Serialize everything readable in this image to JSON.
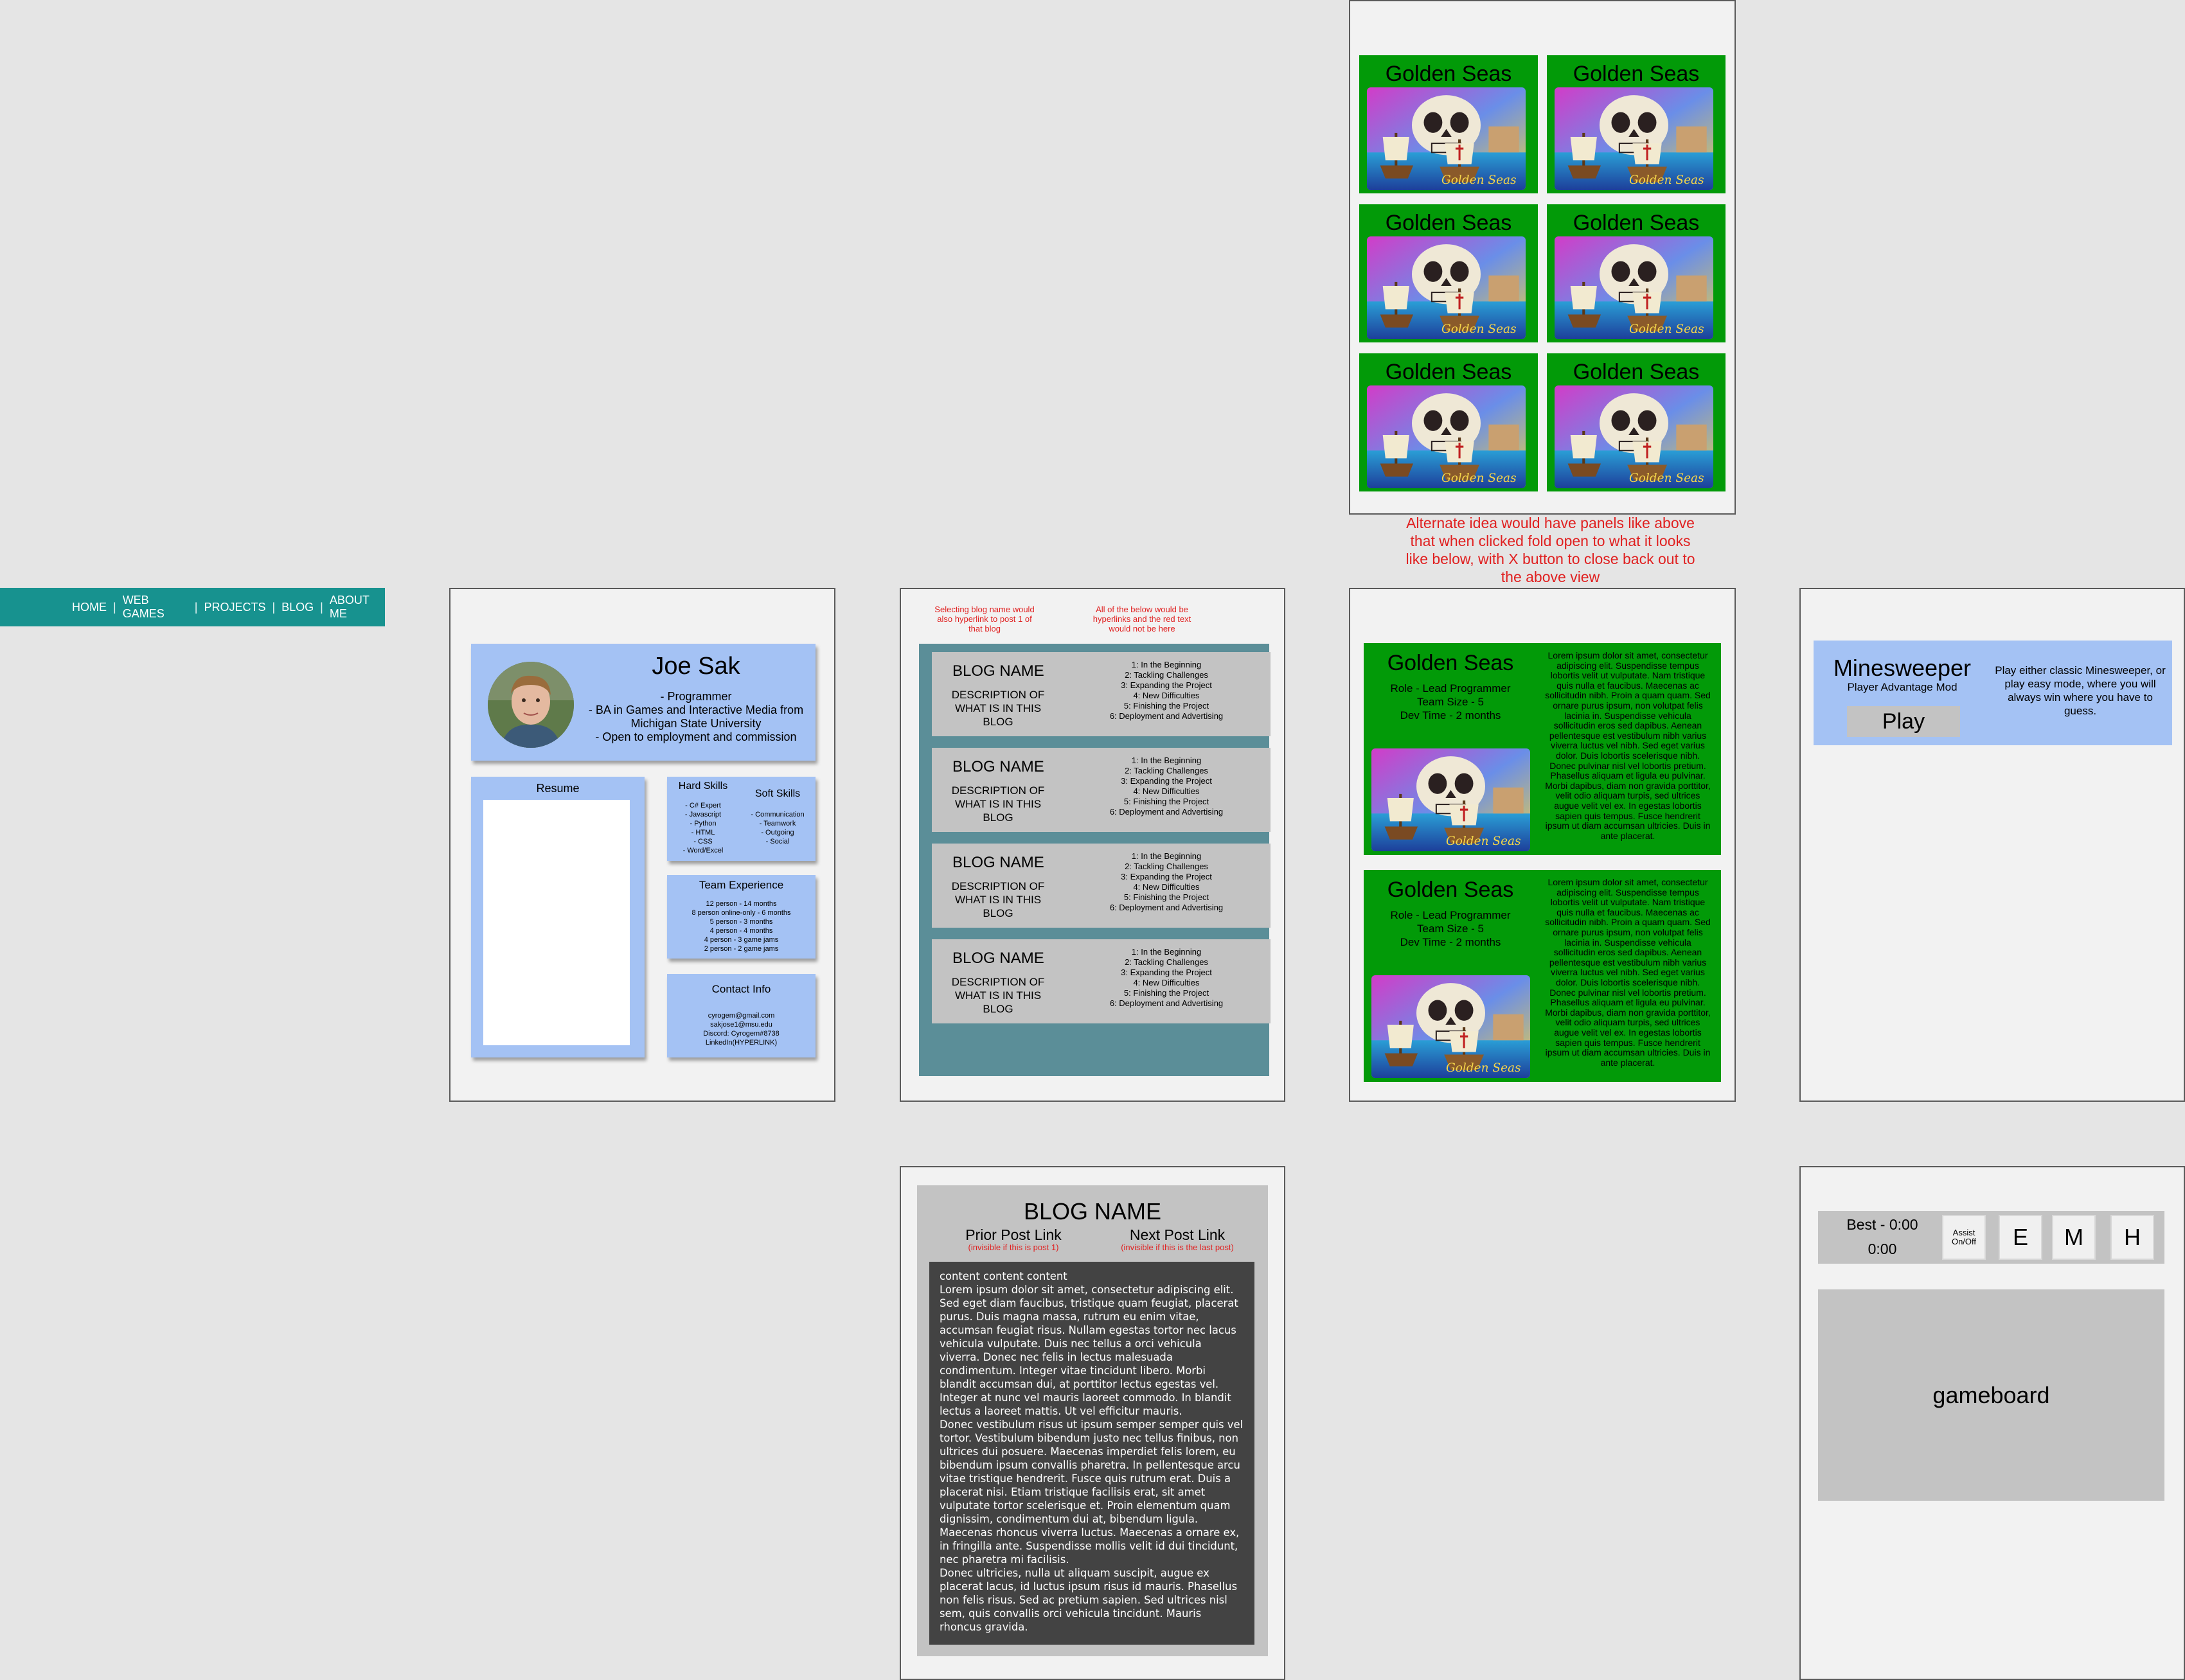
{
  "nav": {
    "items": [
      "HOME",
      "WEB GAMES",
      "PROJECTS",
      "BLOG",
      "ABOUT ME"
    ],
    "separator": "|",
    "color": "#17928f"
  },
  "about": {
    "name": "Joe Sak",
    "bio": [
      "- Programmer",
      "- BA in Games and Interactive Media from Michigan State University",
      "- Open to employment and commission"
    ],
    "resume_title": "Resume",
    "hard_skills_title": "Hard Skills",
    "hard_skills": [
      "- C# Expert",
      "- Javascript",
      "- Python",
      "- HTML",
      "- CSS",
      "- Word/Excel"
    ],
    "soft_skills_title": "Soft Skills",
    "soft_skills": [
      "- Communication",
      "- Teamwork",
      "- Outgoing",
      "- Social"
    ],
    "team_title": "Team Experience",
    "team": [
      "12 person - 14 months",
      "8 person online-only - 6 months",
      "5 person - 3 months",
      "4 person - 4 months",
      "4 person - 3 game jams",
      "2 person - 2 game jams"
    ],
    "contact_title": "Contact Info",
    "contact": [
      "cyrogem@gmail.com",
      "sakjose1@msu.edu",
      "Discord: Cyrogem#8738",
      "LinkedIn(HYPERLINK)"
    ]
  },
  "blog_list": {
    "note_left": "Selecting blog name would also hyperlink to post 1 of that blog",
    "note_right": "All of the below would be hyperlinks and the red text would not be here",
    "item_title": "BLOG NAME",
    "item_desc": "DESCRIPTION OF WHAT IS IN THIS BLOG",
    "toc": [
      "1: In the Beginning",
      "2: Tackling Challenges",
      "3: Expanding the Project",
      "4: New Difficulties",
      "5: Finishing the Project",
      "6: Deployment and Advertising"
    ]
  },
  "games_grid": {
    "title": "Golden Seas",
    "logo_text": "Golden Seas",
    "count": 6
  },
  "alt_note": "Alternate idea would have panels like above that when clicked fold open to what it looks like below, with X button to close back out to the above view",
  "projects": {
    "title": "Golden Seas",
    "role": "Role - Lead Programmer",
    "team": "Team Size - 5",
    "dev": "Dev Time - 2 months",
    "lorem": "Lorem ipsum dolor sit amet, consectetur adipiscing elit. Suspendisse tempus lobortis velit ut vulputate. Nam tristique quis nulla et faucibus. Maecenas ac sollicitudin nibh. Proin a quam quam. Sed ornare purus ipsum, non volutpat felis lacinia in. Suspendisse vehicula sollicitudin eros sed dapibus. Aenean pellentesque est vestibulum nibh varius viverra luctus vel nibh. Sed eget varius dolor. Duis lobortis scelerisque nibh. Donec pulvinar nisl vel lobortis pretium. Phasellus aliquam et ligula eu pulvinar. Morbi dapibus, diam non gravida porttitor, velit odio aliquam turpis, sed ultrices augue velit vel ex. In egestas lobortis sapien quis tempus. Fusce hendrerit ipsum ut diam accumsan ultricies. Duis in ante placerat."
  },
  "minesweeper": {
    "title": "Minesweeper",
    "subtitle": "Player Advantage Mod",
    "play": "Play",
    "desc": "Play either classic Minesweeper, or play easy mode, where you will always win where you have to guess."
  },
  "blog_post": {
    "title": "BLOG NAME",
    "prior": "Prior Post Link",
    "prior_note": "(invisible if this is post 1)",
    "next": "Next Post Link",
    "next_note": "(invisible if this is the last post)",
    "content_head": "content content content",
    "paragraphs": [
      "Lorem ipsum dolor sit amet, consectetur adipiscing elit. Sed eget diam faucibus, tristique quam feugiat, placerat purus. Duis magna massa, rutrum eu enim vitae, accumsan feugiat risus. Nullam egestas tortor nec lacus vehicula vulputate. Duis nec tellus a orci vehicula viverra. Donec nec felis in lectus malesuada condimentum. Integer vitae tincidunt libero. Morbi blandit accumsan dui, at porttitor lectus egestas vel. Integer at nunc vel mauris laoreet commodo. In blandit lectus a laoreet mattis. Ut vel efficitur mauris.",
      "Donec vestibulum risus ut ipsum semper semper quis vel tortor. Vestibulum bibendum justo nec tellus finibus, non ultrices dui posuere. Maecenas imperdiet felis lorem, eu bibendum ipsum convallis pharetra. In pellentesque arcu vitae tristique hendrerit. Fusce quis rutrum erat. Duis a placerat nisi. Etiam tristique facilisis erat, sit amet vulputate tortor scelerisque et. Proin elementum quam dignissim, condimentum dui at, bibendum ligula.",
      "Maecenas rhoncus viverra luctus. Maecenas a ornare ex, in fringilla ante. Suspendisse mollis velit id dui tincidunt, nec pharetra mi facilisis.",
      "Donec ultricies, nulla ut aliquam suscipit, augue ex placerat lacus, id luctus ipsum risus id mauris. Phasellus non felis risus. Sed ac pretium sapien. Sed ultrices nisl sem, quis convallis orci vehicula tincidunt. Mauris rhoncus gravida."
    ]
  },
  "game_screen": {
    "best": "Best - 0:00",
    "time": "0:00",
    "assist": "Assist On/Off",
    "easy": "E",
    "medium": "M",
    "hard": "H",
    "board": "gameboard"
  },
  "colors": {
    "teal_nav": "#17928f",
    "light_blue": "#a4c2f4",
    "golden_green": "#029a08",
    "blog_bg": "#5b8e98",
    "note_red": "#e02020"
  }
}
